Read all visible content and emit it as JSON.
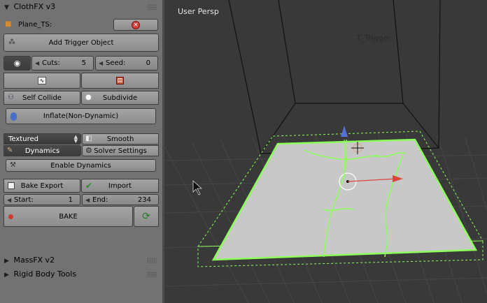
{
  "panel": {
    "clothfx_header": "ClothFX v3",
    "object_name": "Plane_TS:",
    "add_trigger": "Add Trigger Object",
    "cuts_label": "Cuts:",
    "cuts_value": "5",
    "seed_label": "Seed:",
    "seed_value": "0",
    "self_collide": "Self Collide",
    "subdivide": "Subdivide",
    "inflate": "Inflate(Non-Dynamic)",
    "shading_select": "Textured",
    "smooth": "Smooth",
    "dynamics": "Dynamics",
    "solver_settings": "Solver Settings",
    "enable_dynamics": "Enable Dynamics",
    "bake_export": "Bake Export",
    "import": "Import",
    "start_label": "Start:",
    "start_value": "1",
    "end_label": "End:",
    "end_value": "234",
    "bake": "BAKE",
    "massfx_header": "MassFX v2",
    "rigid_header": "Rigid Body Tools"
  },
  "viewport": {
    "view_label": "User Persp",
    "object_label": "T_Trigger"
  },
  "colors": {
    "panel_bg": "#727272",
    "viewport_bg": "#393939",
    "selection_green": "#8cff5a",
    "cloth_surface": "#c8c8c8",
    "button_dark": "#3f3f3f",
    "close_red": "#d83a3a",
    "bake_record_red": "#cc3b2a"
  },
  "icons": {
    "cube": "cube-icon",
    "close": "close-icon",
    "eye": "eye-icon",
    "graph": "graph-icon",
    "dice": "dice-icon",
    "collide": "collide-icon",
    "subdivide": "sphere-icon",
    "inflate": "balloon-icon",
    "smooth": "smooth-icon",
    "dynamics": "dynamics-icon",
    "solver": "gear-icon",
    "enable": "wand-icon",
    "bake_export": "save-icon",
    "import": "checkmark-icon",
    "bake_record": "record-icon",
    "refresh": "refresh-icon"
  }
}
